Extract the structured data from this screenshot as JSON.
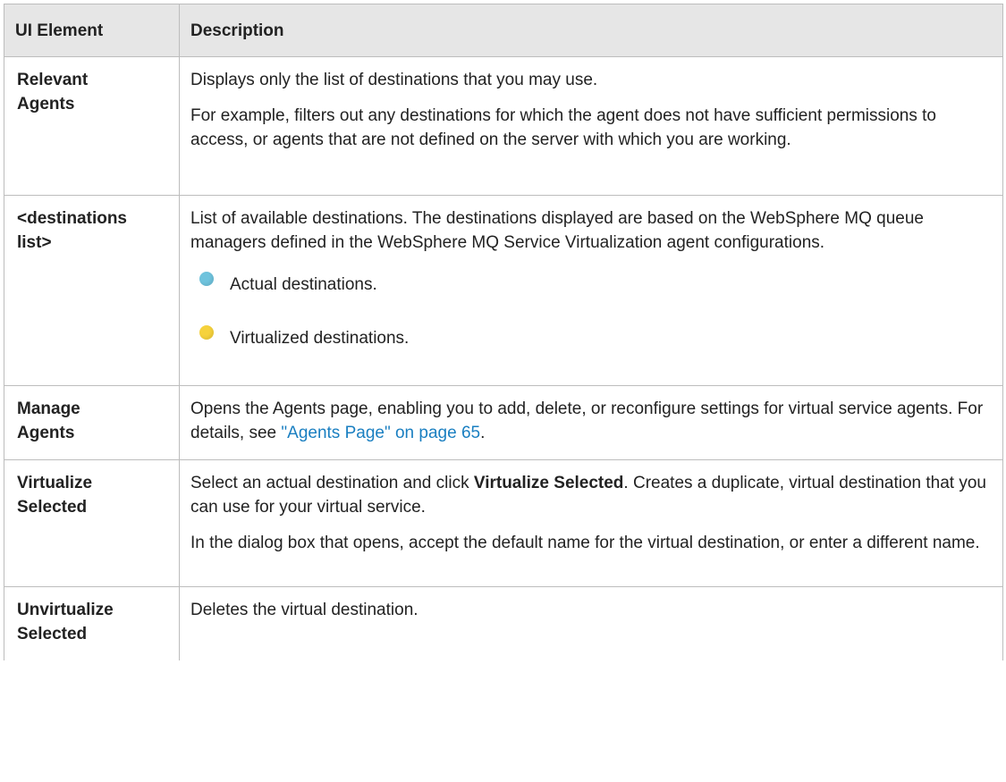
{
  "header": {
    "col1": "UI Element",
    "col2": "Description"
  },
  "rows": [
    {
      "element": [
        "Relevant",
        "Agents"
      ],
      "p1": "Displays only the list of destinations that you may use.",
      "p2": "For example, filters out any destinations for which the agent does not have sufficient permissions to access, or agents that are not defined on the server with which you are working."
    },
    {
      "element": [
        "<destinations",
        "list>"
      ],
      "p1": "List of available destinations. The destinations displayed are based on the WebSphere MQ queue managers defined in the WebSphere MQ Service Virtualization agent configurations.",
      "legend_actual": "Actual destinations.",
      "legend_virtual": "Virtualized destinations.",
      "legend_actual_icon": "blue-circle-icon",
      "legend_virtual_icon": "yellow-circle-icon"
    },
    {
      "element": [
        "Manage",
        "Agents"
      ],
      "p1_before": "Opens the Agents page, enabling you to add, delete, or reconfigure settings for virtual service agents. For details, see ",
      "link": "\"Agents Page\" on page 65",
      "p1_after": "."
    },
    {
      "element": [
        "Virtualize",
        "Selected"
      ],
      "p1_before": "Select an actual destination and click ",
      "p1_bold": "Virtualize Selected",
      "p1_after": ". Creates a duplicate, virtual destination that you can use for your virtual service.",
      "p2": "In the dialog box that opens, accept the default name for the virtual destination, or enter a different name."
    },
    {
      "element": [
        "Unvirtualize",
        "Selected"
      ],
      "p1": "Deletes the virtual destination."
    }
  ],
  "colors": {
    "header_bg": "#e6e6e6",
    "border": "#bdbdbd",
    "link": "#1a7fc1",
    "actual_dot": "#6fc3dd",
    "virtual_dot": "#f6d23c"
  }
}
